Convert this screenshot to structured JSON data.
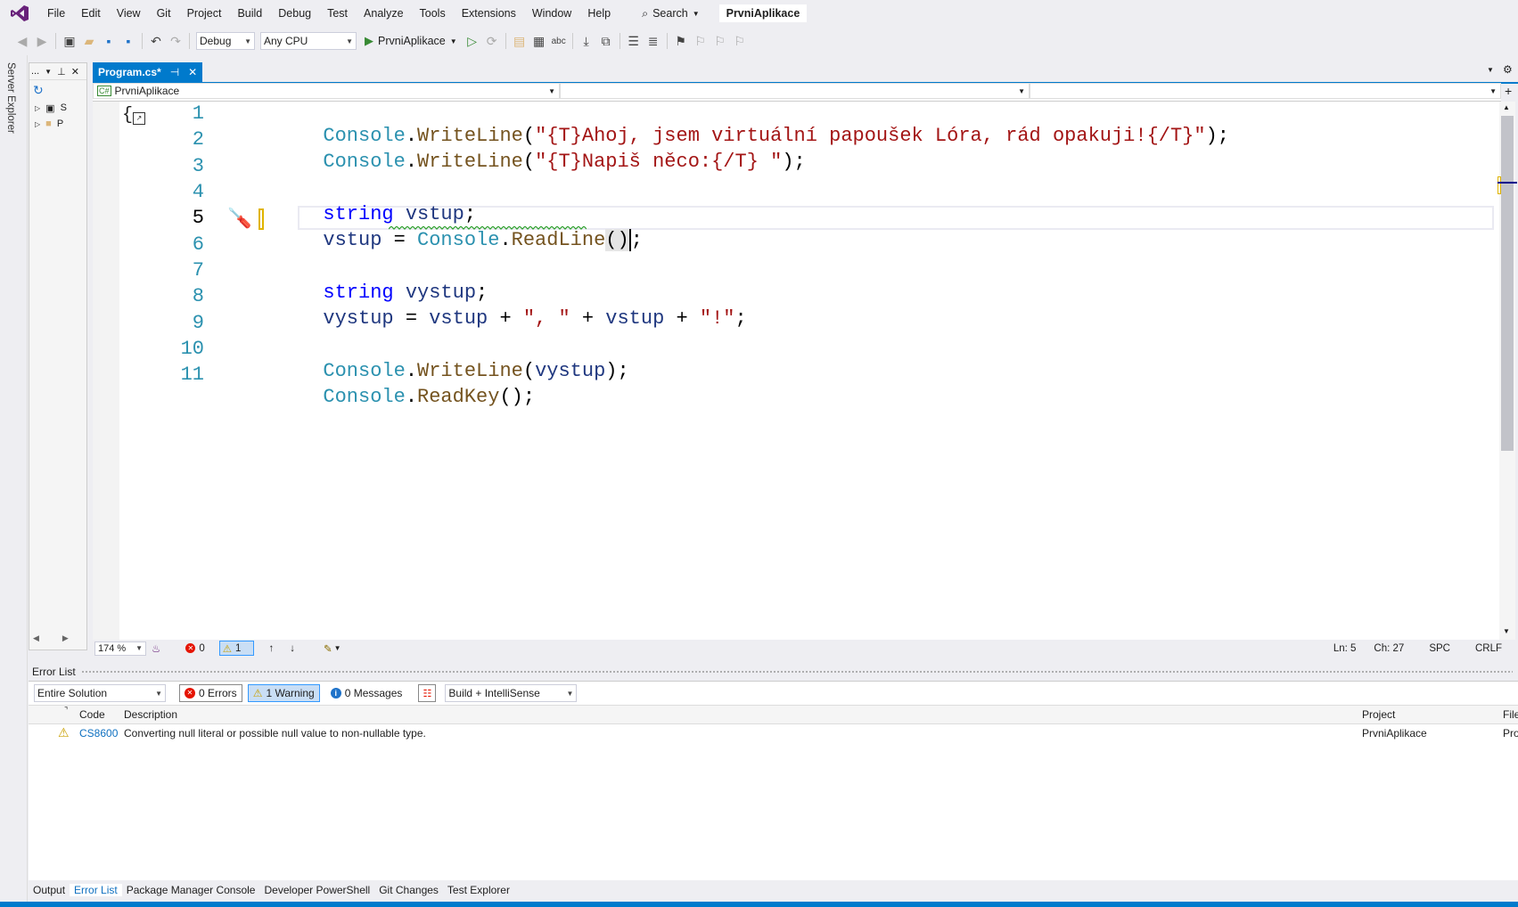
{
  "menu": {
    "items": [
      "File",
      "Edit",
      "View",
      "Git",
      "Project",
      "Build",
      "Debug",
      "Test",
      "Analyze",
      "Tools",
      "Extensions",
      "Window",
      "Help"
    ],
    "search_label": "Search",
    "solution_name": "PrvniAplikace"
  },
  "toolbar": {
    "config": "Debug",
    "platform": "Any CPU",
    "run_target": "PrvniAplikace"
  },
  "server_explorer": {
    "label": "Server Explorer"
  },
  "solution_panel": {
    "title": "...",
    "items": [
      "S",
      "P"
    ]
  },
  "editor": {
    "tab_label": "Program.cs*",
    "nav_project": "PrvniAplikace",
    "line_numbers": [
      "1",
      "2",
      "3",
      "4",
      "5",
      "6",
      "7",
      "8",
      "9",
      "10",
      "11"
    ],
    "current_line": "5",
    "code": {
      "l1": {
        "cls": "Console",
        "dot": ".",
        "mth": "WriteLine",
        "open": "(",
        "str": "\"{T}Ahoj, jsem virtuální papoušek Lóra, rád opakuji!{/T}\"",
        "close": ");"
      },
      "l2": {
        "cls": "Console",
        "dot": ".",
        "mth": "WriteLine",
        "open": "(",
        "str": "\"{T}Napiš něco:{/T} \"",
        "close": ");"
      },
      "l4": {
        "kw": "string",
        "var": " vstup",
        "end": ";"
      },
      "l5": {
        "var": "vstup",
        "op": " = ",
        "cls": "Console",
        "dot": ".",
        "mth": "ReadLine",
        "paren": "()",
        "end": ";"
      },
      "l7": {
        "kw": "string",
        "var": " vystup",
        "end": ";"
      },
      "l8": {
        "var1": "vystup",
        "op1": " = ",
        "var2": "vstup",
        "op2": " + ",
        "str1": "\", \"",
        "op3": " + ",
        "var3": "vstup",
        "op4": " + ",
        "str2": "\"!\"",
        "end": ";"
      },
      "l10": {
        "cls": "Console",
        "dot": ".",
        "mth": "WriteLine",
        "open": "(",
        "var": "vystup",
        "close": ");"
      },
      "l11": {
        "cls": "Console",
        "dot": ".",
        "mth": "ReadKey",
        "close": "();"
      }
    }
  },
  "editor_status": {
    "zoom": "174 %",
    "errors": "0",
    "warnings": "1",
    "line": "Ln: 5",
    "col": "Ch: 27",
    "spacing": "SPC",
    "eol": "CRLF"
  },
  "error_list": {
    "title": "Error List",
    "scope": "Entire Solution",
    "errors_btn": "0 Errors",
    "warnings_btn": "1 Warning",
    "messages_btn": "0 Messages",
    "source": "Build + IntelliSense",
    "columns": {
      "code": "Code",
      "description": "Description",
      "project": "Project",
      "file": "File"
    },
    "rows": [
      {
        "code": "CS8600",
        "description": "Converting null literal or possible null value to non-nullable type.",
        "project": "PrvniAplikace",
        "file": "Pro"
      }
    ]
  },
  "bottom_tabs": [
    "Output",
    "Error List",
    "Package Manager Console",
    "Developer PowerShell",
    "Git Changes",
    "Test Explorer"
  ],
  "colors": {
    "accent": "#007acc",
    "class": "#2b91af",
    "string": "#a31515",
    "keyword": "#0000ff",
    "method": "#74531f",
    "variable": "#1f377f"
  }
}
